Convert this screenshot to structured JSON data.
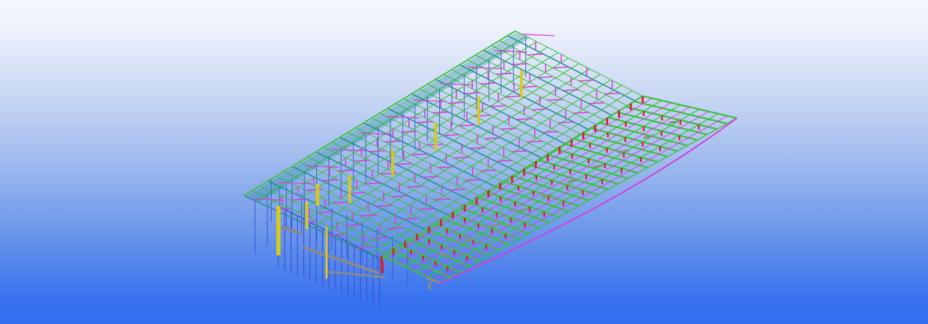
{
  "viewport": {
    "background": {
      "top": "#f4f7fd",
      "middle": "#98b6ee",
      "bottom": "#326dee"
    }
  },
  "model": {
    "kind": "3d-steel-structure-wireframe",
    "colors": {
      "roof_purlin": "#3fbf3f",
      "primary_frame": "#1c8f8f",
      "bracing": "#d63cd6",
      "column_yellow": "#d8c81f",
      "column_blue": "#3a4fd6",
      "beam_grey": "#8a8a8a",
      "splice_red": "#d6202e"
    }
  }
}
